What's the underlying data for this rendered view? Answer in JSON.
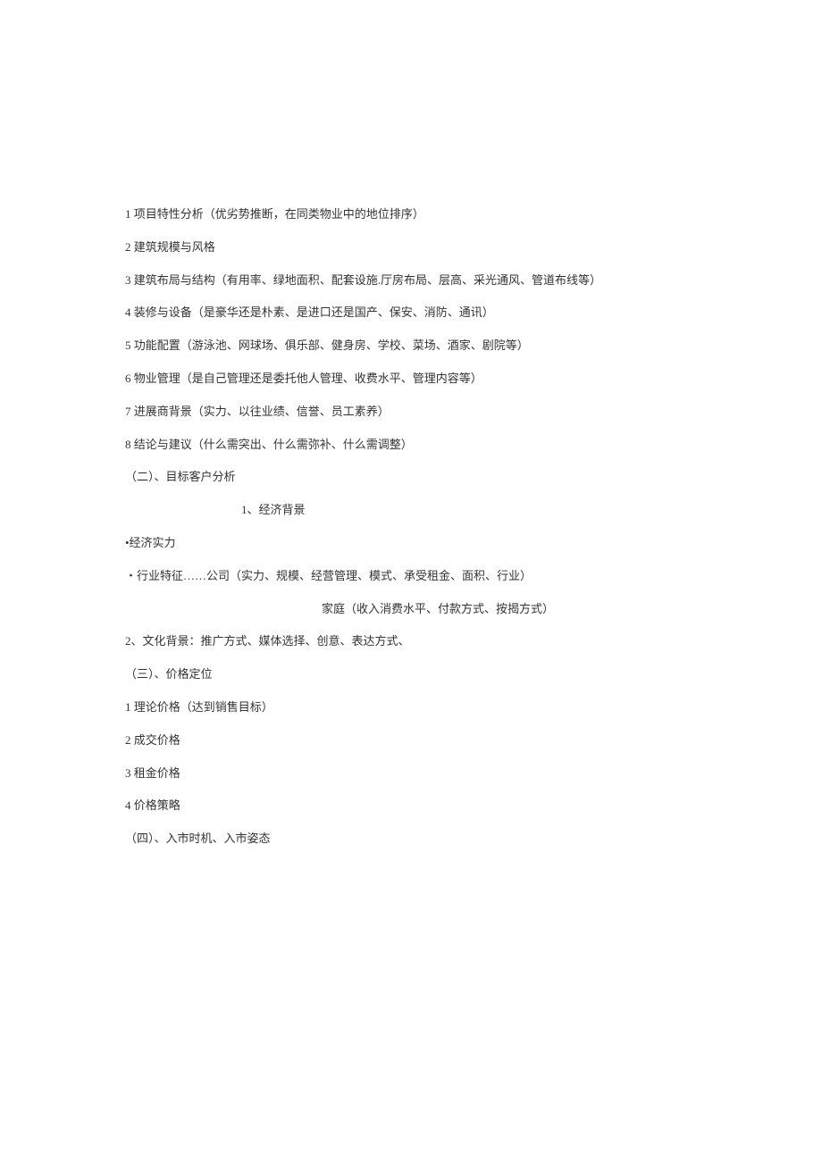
{
  "lines": {
    "l1": "1 项目特性分析（优劣势推断，在同类物业中的地位排序）",
    "l2": "2 建筑规模与风格",
    "l3": "3 建筑布局与结构（有用率、绿地面积、配套设施.厅房布局、层高、采光通风、管道布线等）",
    "l4": "4 装修与设备（是豪华还是朴素、是进口还是国产、保安、消防、通讯）",
    "l5": "5 功能配置（游泳池、网球场、俱乐部、健身房、学校、菜场、酒家、剧院等）",
    "l6": "6 物业管理（是自己管理还是委托他人管理、收费水平、管理内容等）",
    "l7": "7 进展商背景（实力、以往业绩、信誉、员工素养）",
    "l8": "8 结论与建议（什么需突出、什么需弥补、什么需调整）",
    "l9": "（二）、目标客户分析",
    "l10": "1、经济背景",
    "l11": "•经济实力",
    "l12": "・行业特征……公司（实力、规模、经营管理、模式、承受租金、面积、行业）",
    "l13": "家庭（收入消费水平、付款方式、按揭方式）",
    "l14": "2、文化背景：推广方式、媒体选择、创意、表达方式、",
    "l15": "（三）、价格定位",
    "l16": "1 理论价格（达到销售目标）",
    "l17": "2 成交价格",
    "l18": "3 租金价格",
    "l19": "4 价格策略",
    "l20": "（四）、入市时机、入市姿态"
  }
}
